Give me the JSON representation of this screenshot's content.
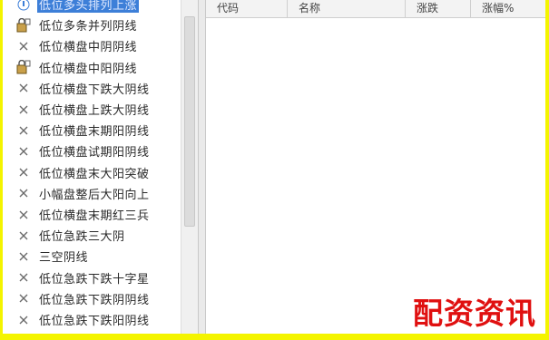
{
  "tree": {
    "items": [
      {
        "label": "低位多头排列上涨",
        "icon": "info-icon",
        "selected": true
      },
      {
        "label": "低位多条并列阴线",
        "icon": "lock-icon"
      },
      {
        "label": "低位横盘中阴阴线",
        "icon": "close-icon"
      },
      {
        "label": "低位横盘中阳阴线",
        "icon": "lock-icon"
      },
      {
        "label": "低位横盘下跌大阴线",
        "icon": "close-icon"
      },
      {
        "label": "低位横盘上跌大阴线",
        "icon": "close-icon"
      },
      {
        "label": "低位横盘末期阳阴线",
        "icon": "close-icon"
      },
      {
        "label": "低位横盘试期阳阴线",
        "icon": "close-icon"
      },
      {
        "label": "低位横盘末大阳突破",
        "icon": "close-icon"
      },
      {
        "label": "小幅盘整后大阳向上",
        "icon": "close-icon"
      },
      {
        "label": "低位横盘末期红三兵",
        "icon": "close-icon"
      },
      {
        "label": "低位急跌三大阴",
        "icon": "close-icon"
      },
      {
        "label": "三空阴线",
        "icon": "close-icon"
      },
      {
        "label": "低位急跌下跌十字星",
        "icon": "close-icon"
      },
      {
        "label": "低位急跌下跌阴阴线",
        "icon": "close-icon"
      },
      {
        "label": "低位急跌下跌阳阴线",
        "icon": "close-icon"
      }
    ]
  },
  "grid": {
    "columns": [
      "代码",
      "名称",
      "涨跌",
      "涨幅%"
    ]
  },
  "watermark": "配资资讯",
  "colors": {
    "frame": "#f4f400",
    "selection": "#3d7fd8",
    "watermark": "#e01010"
  }
}
